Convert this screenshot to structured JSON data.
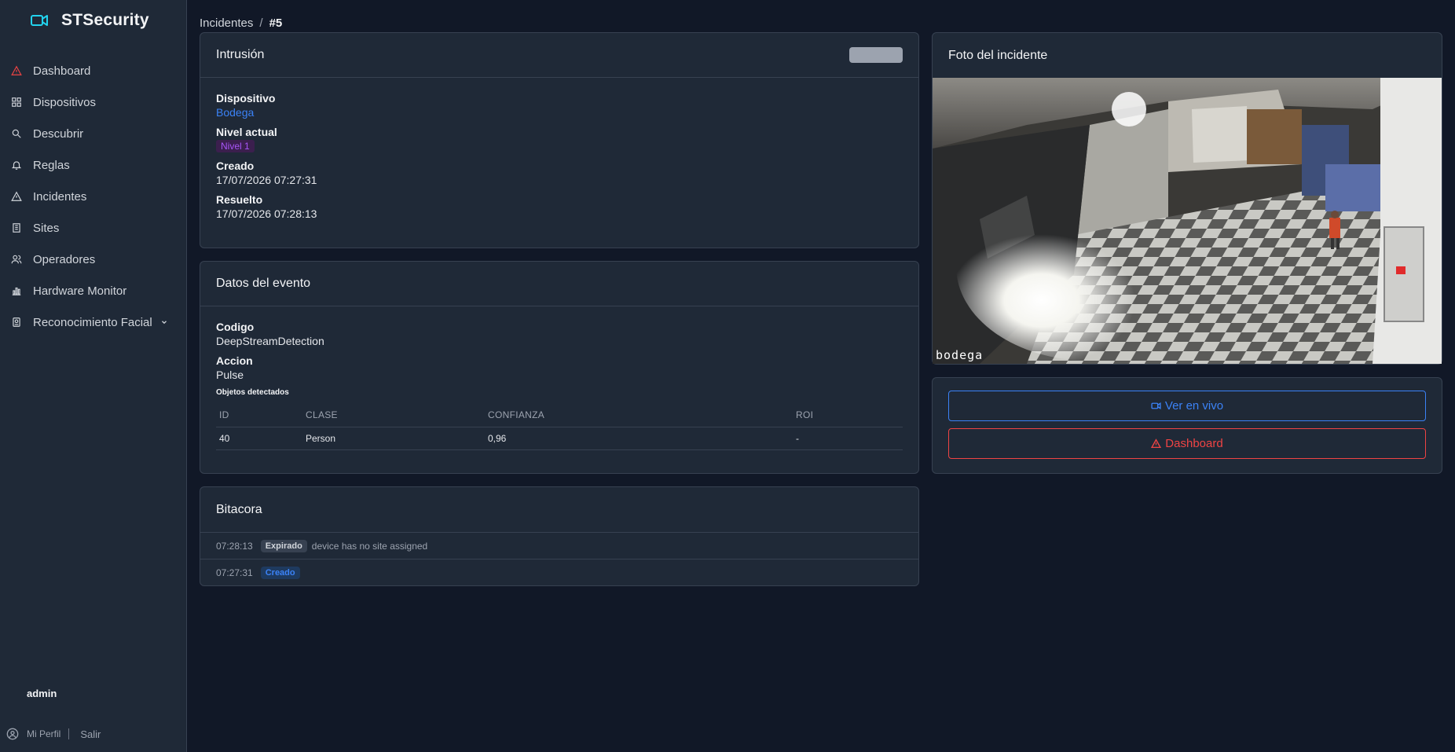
{
  "brand": {
    "name": "STSecurity",
    "accent": "#22d3ee"
  },
  "sidebar": {
    "items": [
      {
        "label": "Dashboard",
        "icon": "alert-triangle-icon",
        "icon_color": "#ef4444"
      },
      {
        "label": "Dispositivos",
        "icon": "grid-icon"
      },
      {
        "label": "Descubrir",
        "icon": "search-icon"
      },
      {
        "label": "Reglas",
        "icon": "bell-icon"
      },
      {
        "label": "Incidentes",
        "icon": "alert-triangle-icon"
      },
      {
        "label": "Sites",
        "icon": "building-icon"
      },
      {
        "label": "Operadores",
        "icon": "users-icon"
      },
      {
        "label": "Hardware Monitor",
        "icon": "bar-chart-icon"
      },
      {
        "label": "Reconocimiento Facial",
        "icon": "badge-icon",
        "expandable": true
      }
    ],
    "user": {
      "name": "admin",
      "profile_label": "Mi Perfil",
      "logout_label": "Salir"
    }
  },
  "breadcrumb": {
    "parent": "Incidentes",
    "separator": "/",
    "current": "#5"
  },
  "incident": {
    "title": "Intrusión",
    "device_label": "Dispositivo",
    "device_value": "Bodega",
    "level_label": "Nivel actual",
    "level_value": "Nivel 1",
    "created_label": "Creado",
    "created_value": "17/07/2026 07:27:31",
    "resolved_label": "Resuelto",
    "resolved_value": "17/07/2026 07:28:13"
  },
  "event": {
    "title": "Datos del evento",
    "code_label": "Codigo",
    "code_value": "DeepStreamDetection",
    "action_label": "Accion",
    "action_value": "Pulse",
    "objects_label": "Objetos detectados",
    "columns": [
      "ID",
      "CLASE",
      "CONFIANZA",
      "ROI"
    ],
    "rows": [
      [
        "40",
        "Person",
        "0,96",
        "-"
      ]
    ]
  },
  "log": {
    "title": "Bitacora",
    "entries": [
      {
        "time": "07:28:13",
        "tag": "Expirado",
        "text": "device has no site assigned"
      },
      {
        "time": "07:27:31",
        "tag": "Creado",
        "text": ""
      }
    ]
  },
  "photo": {
    "title": "Foto del incidente",
    "camera_label": "bodega"
  },
  "actions": {
    "live_label": "Ver en vivo",
    "dashboard_label": "Dashboard"
  }
}
